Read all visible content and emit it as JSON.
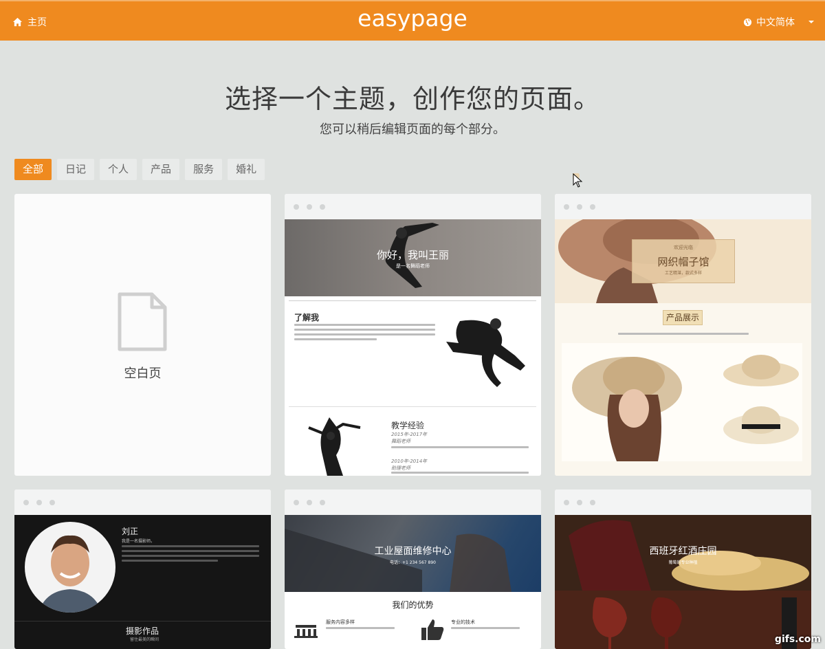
{
  "header": {
    "home_label": "主页",
    "logo_text": "easypage",
    "language": "中文简体",
    "brand_color": "#ef8a1f"
  },
  "hero": {
    "title": "选择一个主题，创作您的页面。",
    "subtitle": "您可以稍后编辑页面的每个部分。"
  },
  "filters": [
    {
      "label": "全部",
      "active": true
    },
    {
      "label": "日记",
      "active": false
    },
    {
      "label": "个人",
      "active": false
    },
    {
      "label": "产品",
      "active": false
    },
    {
      "label": "服务",
      "active": false
    },
    {
      "label": "婚礼",
      "active": false
    }
  ],
  "templates": {
    "blank": {
      "label": "空白页",
      "icon": "blank-page-icon"
    },
    "dancer": {
      "hero_title": "你好，我叫王丽",
      "hero_sub": "是一名舞蹈老师",
      "about_title": "了解我",
      "exp_title": "教学经验",
      "exp_year1": "2015年-2017年",
      "exp_role1": "舞蹈老师",
      "exp_year2": "2010年-2014年",
      "exp_role2": "助理老师"
    },
    "hats": {
      "welcome": "欢迎光临",
      "hero_title": "网织帽子馆",
      "hero_sub": "工艺精湛，款式多样",
      "section_title": "产品展示"
    },
    "personal": {
      "name": "刘正",
      "intro": "我是一名摄影师。",
      "works_title": "摄影作品",
      "works_sub": "留住最美的瞬间"
    },
    "roof": {
      "hero_title": "工业屋面维修中心",
      "phone": "电话：+1 234 567 890",
      "section_title": "我们的优势",
      "feature1": "服务内容多样",
      "feature2": "专业的技术"
    },
    "wine": {
      "hero_title": "西班牙红酒庄园",
      "hero_sub": "葡萄的专业种植"
    }
  },
  "watermark": "gifs.com"
}
